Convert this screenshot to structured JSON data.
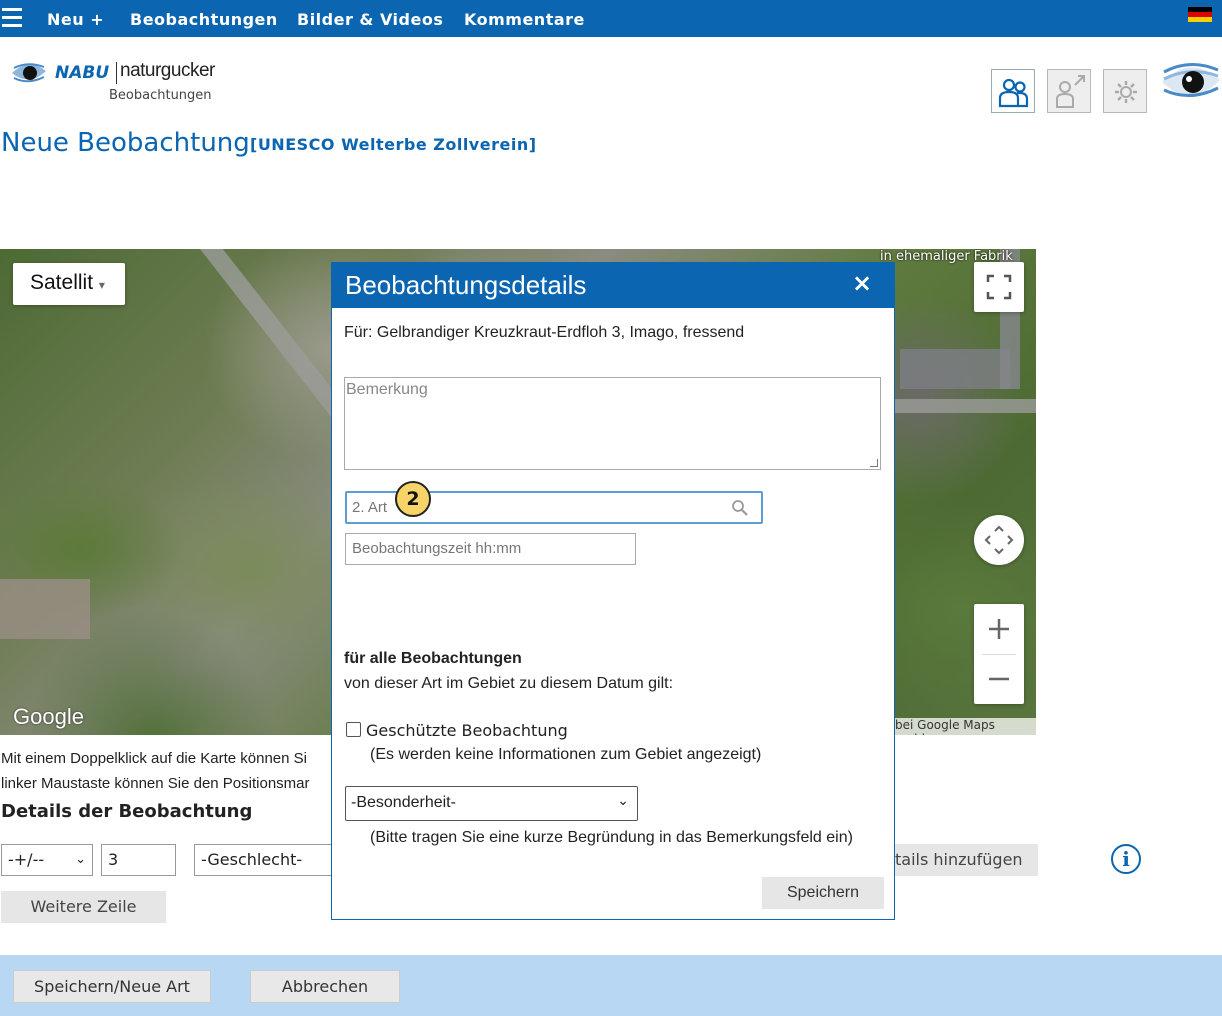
{
  "nav": {
    "items": [
      "Neu +",
      "Beobachtungen",
      "Bilder & Videos",
      "Kommentare"
    ]
  },
  "logo": {
    "brand": "NABU",
    "name": "naturgucker",
    "subtitle": "Beobachtungen"
  },
  "header_icons": [
    "users-icon",
    "user-share-icon",
    "settings-icon",
    "naturgucker-eye-logo"
  ],
  "page": {
    "title": "Neue Beobachtung",
    "subtitle": "[UNESCO Welterbe Zollverein]"
  },
  "map": {
    "type_control": "Satellit",
    "attribution": "Google",
    "report": "bei Google Maps melden",
    "poi_label": "in ehemaliger Fabrik"
  },
  "hint": {
    "line1": "Mit einem Doppelklick auf die Karte können Si",
    "line2": "linker Maustaste können Sie den Positionsmar"
  },
  "details": {
    "heading": "Details der Beobachtung",
    "precision_select": "-+/--",
    "count_value": "3",
    "sex_select": "-Geschlecht-",
    "add_details": "tails hinzufügen",
    "more_row": "Weitere Zeile"
  },
  "footer": {
    "save_new": "Speichern/Neue Art",
    "cancel": "Abbrechen"
  },
  "modal": {
    "title": "Beobachtungsdetails",
    "close": "×",
    "for_text": "Für: Gelbrandiger Kreuzkraut-Erdfloh 3, Imago, fressend",
    "remark_placeholder": "Bemerkung",
    "second_species_placeholder": "2. Art",
    "step_badge": "2",
    "time_placeholder": "Beobachtungszeit hh:mm",
    "all_obs_heading": "für alle Beobachtungen",
    "all_obs_text": "von dieser Art im Gebiet zu diesem Datum gilt:",
    "protected_label": "Geschützte Beobachtung",
    "protected_note": "(Es werden keine Informationen zum Gebiet angezeigt)",
    "special_select": "-Besonderheit-",
    "special_note": "(Bitte tragen Sie eine kurze Begründung in das Bemerkungsfeld ein)",
    "save": "Speichern"
  },
  "colors": {
    "primary": "#0b65b0",
    "footer_bg": "#b8d7f3",
    "badge": "#f7d468"
  }
}
